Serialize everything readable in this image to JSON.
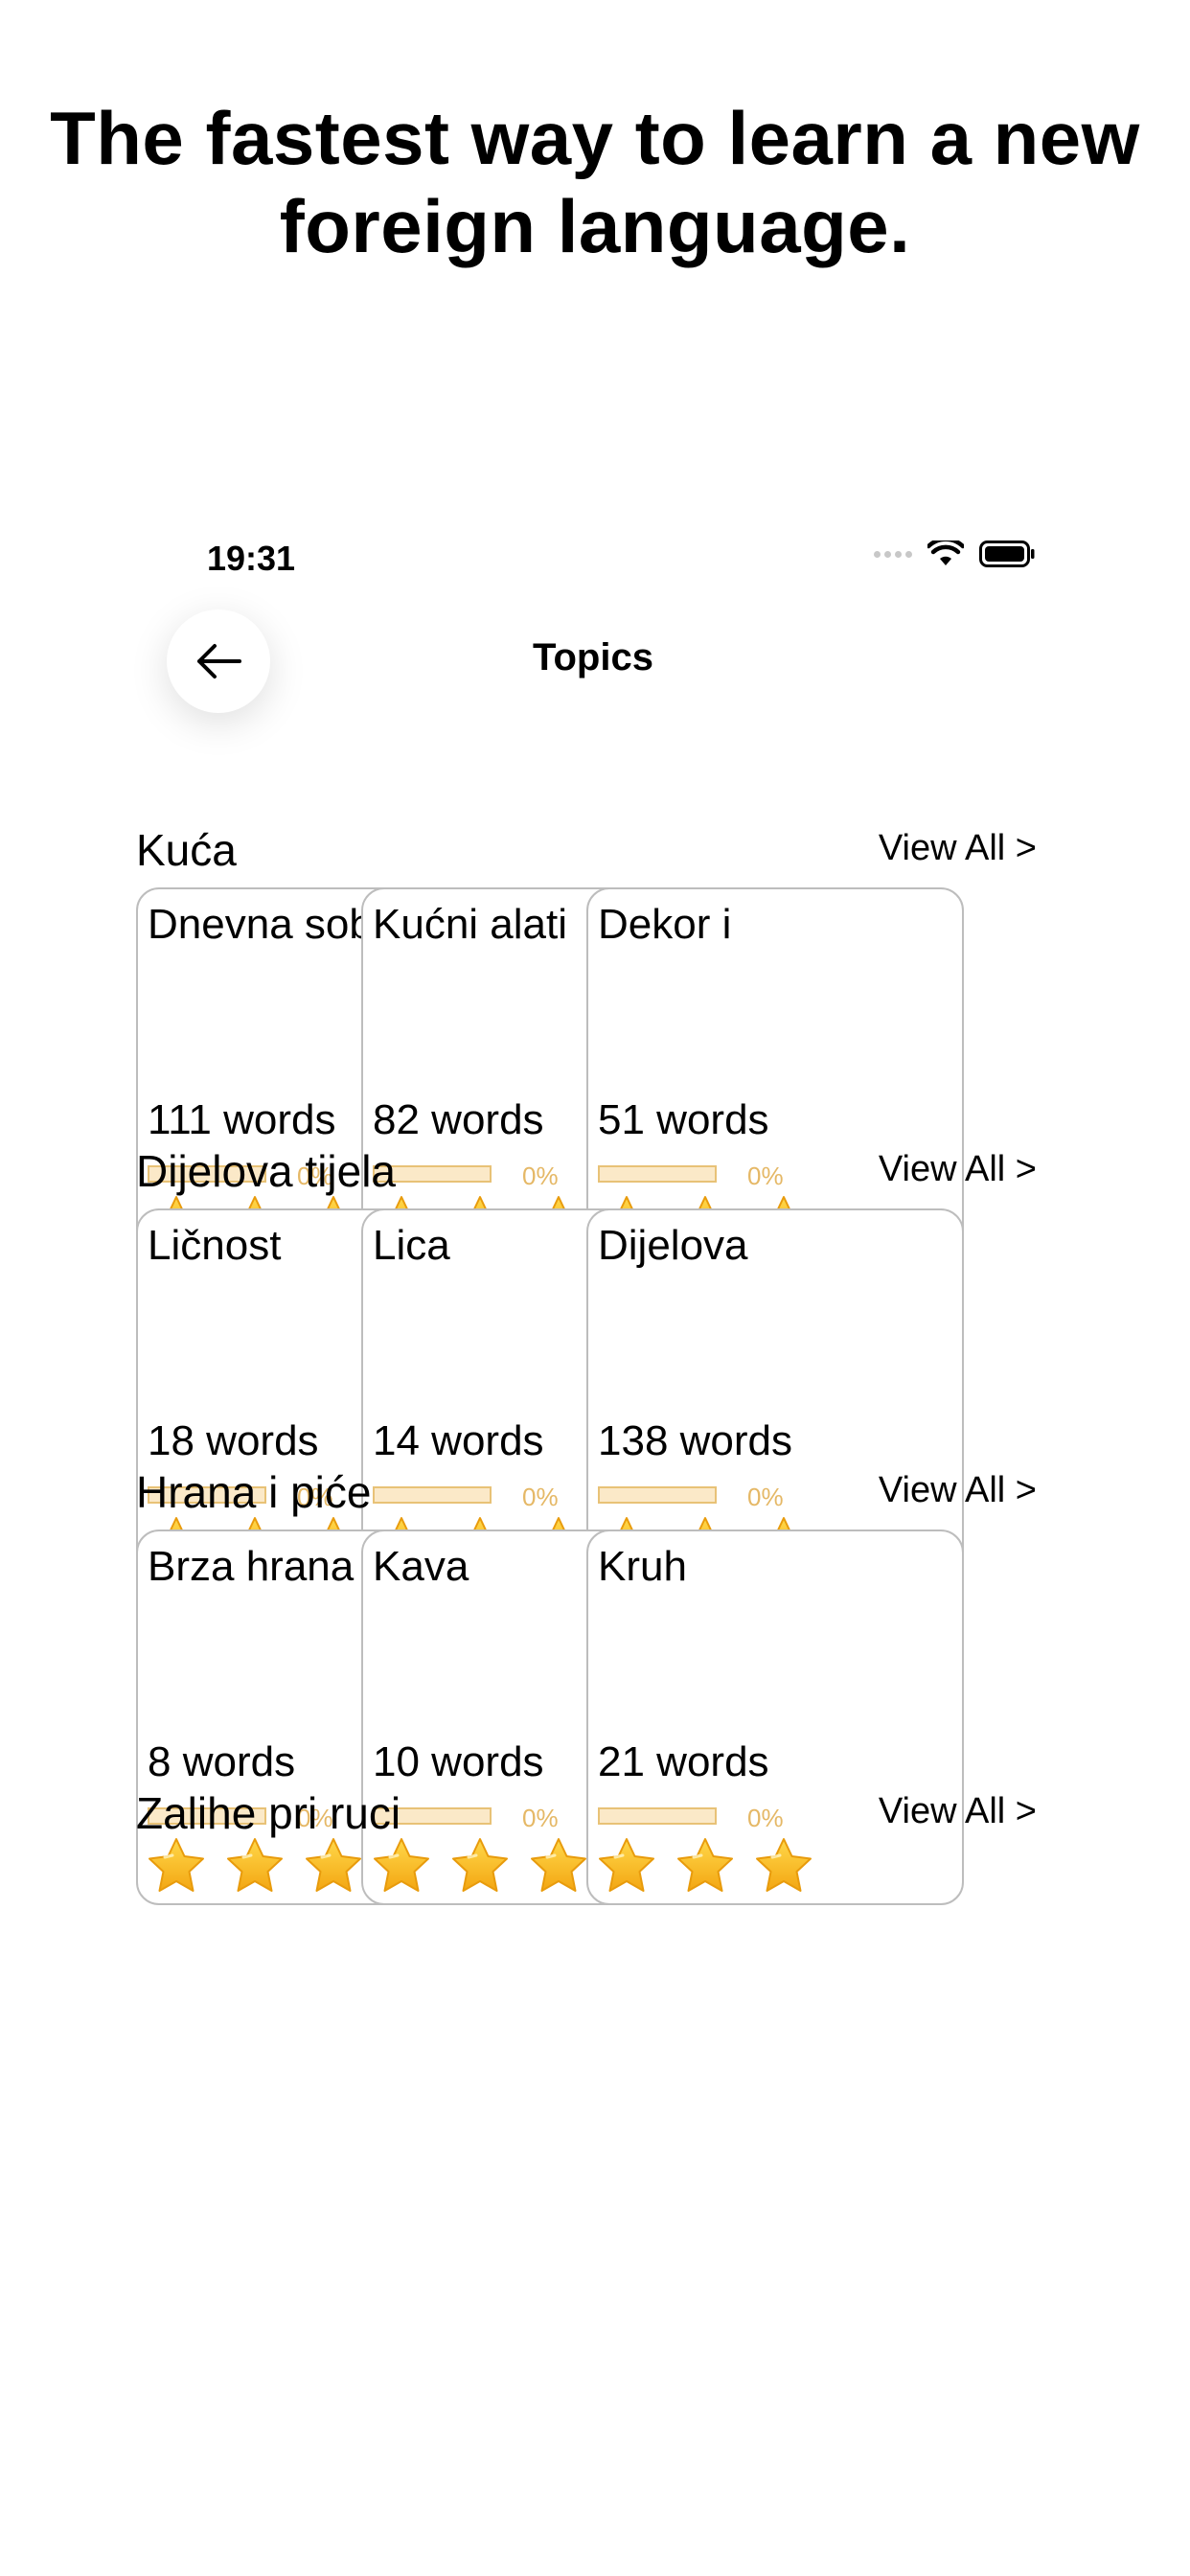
{
  "headline": "The fastest way to learn a new foreign language.",
  "status_bar": {
    "time": "19:31"
  },
  "nav": {
    "title": "Topics"
  },
  "sections": [
    {
      "title": "Kuća",
      "view_all": "View All >",
      "cards": [
        {
          "title": "Dnevna soba",
          "words": "111 words",
          "progress": "0%",
          "progress_value": 0,
          "stars": 3,
          "icon": "living-room-icon"
        },
        {
          "title": "Kućni alati",
          "words": "82 words",
          "progress": "0%",
          "progress_value": 0,
          "stars": 3,
          "icon": "toolbox-icon"
        },
        {
          "title": "Dekor i",
          "words": "51 words",
          "progress": "0%",
          "progress_value": 0,
          "stars": 3,
          "icon": "decor-icon"
        }
      ]
    },
    {
      "title": "Dijelova tijela",
      "view_all": "View All >",
      "cards": [
        {
          "title": "Ličnost",
          "words": "18 words",
          "progress": "0%",
          "progress_value": 0,
          "stars": 3,
          "icon": "personality-masks-icon"
        },
        {
          "title": "Lica",
          "words": "14 words",
          "progress": "0%",
          "progress_value": 0,
          "stars": 3,
          "icon": "face-scan-icon"
        },
        {
          "title": "Dijelova",
          "words": "138 words",
          "progress": "0%",
          "progress_value": 0,
          "stars": 3,
          "icon": "body-icon"
        }
      ]
    },
    {
      "title": "Hrana i piće",
      "view_all": "View All >",
      "cards": [
        {
          "title": "Brza hrana",
          "words": "8 words",
          "progress": "0%",
          "progress_value": 0,
          "stars": 3,
          "icon": "fast-food-icon"
        },
        {
          "title": "Kava",
          "words": "10 words",
          "progress": "0%",
          "progress_value": 0,
          "stars": 3,
          "icon": "coffee-icon"
        },
        {
          "title": "Kruh",
          "words": "21 words",
          "progress": "0%",
          "progress_value": 0,
          "stars": 3,
          "icon": "bread-icon"
        }
      ]
    },
    {
      "title": "Zalihe pri ruci",
      "view_all": "View All >",
      "cards": []
    }
  ],
  "colors": {
    "star": "#f7b51c",
    "progress_track": "#fbe9c8",
    "progress_border": "#e8c277",
    "card_border": "#bdbdbd"
  }
}
